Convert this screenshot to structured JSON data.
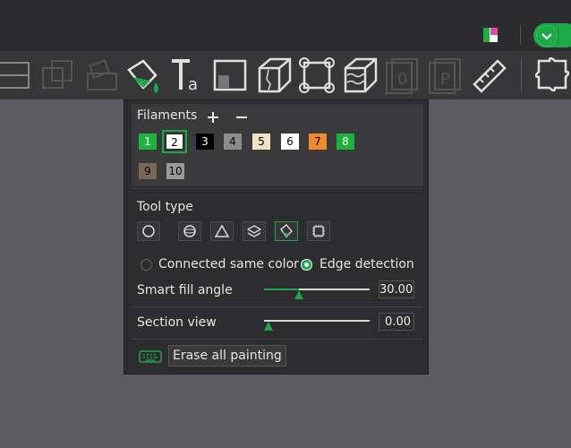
{
  "filaments": {
    "title": "Filaments",
    "add_icon": "plus-icon",
    "remove_icon": "minus-icon",
    "items": [
      {
        "label": "1",
        "color": "#1db33a",
        "text": "#ffffff"
      },
      {
        "label": "2",
        "color": "#ffffff",
        "text": "#000000",
        "selected": true
      },
      {
        "label": "3",
        "color": "#000000",
        "text": "#ffffff"
      },
      {
        "label": "4",
        "color": "#8c8c8c",
        "text": "#000000"
      },
      {
        "label": "5",
        "color": "#f1e3c4",
        "text": "#000000"
      },
      {
        "label": "6",
        "color": "#ffffff",
        "text": "#000000"
      },
      {
        "label": "7",
        "color": "#f08a2a",
        "text": "#000000"
      },
      {
        "label": "8",
        "color": "#1db33a",
        "text": "#ffffff"
      },
      {
        "label": "9",
        "color": "#7a6654",
        "text": "#000000"
      },
      {
        "label": "10",
        "color": "#9a9a9a",
        "text": "#000000"
      }
    ]
  },
  "tool_type": {
    "title": "Tool type",
    "tools": [
      "circle-tool-icon",
      "sphere-tool-icon",
      "triangle-tool-icon",
      "layers-tool-icon",
      "fill-bucket-tool-icon",
      "gap-fill-tool-icon"
    ],
    "selected_index": 4
  },
  "fill_mode": {
    "option_1": "Connected same color",
    "option_2": "Edge detection",
    "selected": "Edge detection"
  },
  "smart_fill": {
    "label": "Smart fill angle",
    "value": "30.00",
    "fraction": 0.33
  },
  "section_view": {
    "label": "Section view",
    "value": "0.00",
    "fraction": 0.0
  },
  "erase_button": {
    "label": "Erase all painting",
    "icon": "keyboard-icon"
  },
  "colors": {
    "accent": "#1fa84a",
    "panel": "#2d2d30"
  }
}
